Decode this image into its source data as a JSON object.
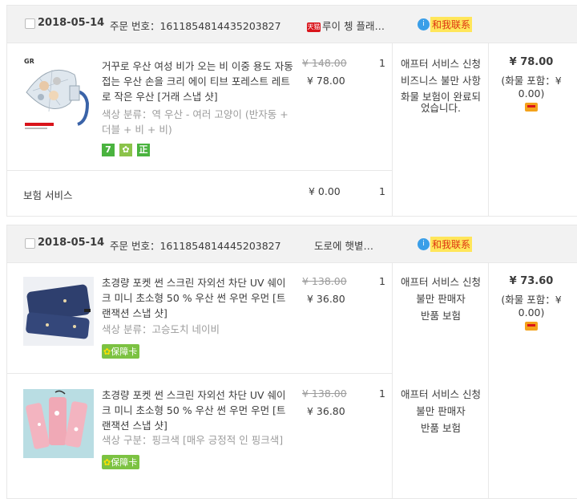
{
  "orders": [
    {
      "date": "2018-05-14",
      "order_no_label": "주문 번호：",
      "order_no": "1611854814435203827",
      "shop": {
        "tmall_label": "天猫",
        "name": "루이 쳉 플래…"
      },
      "contact": {
        "bubble": "i",
        "label": "和我联系"
      },
      "items": [
        {
          "title": "거꾸로 우산 여성 비가 오는 비 이중 용도 자동 접는 우산 손을 크리 에이 티브 포레스트 레트로 작은 우산 [거래 스냅 샷]",
          "sku": "색상 분류：역 우산 - 여러 고양이 (반자동 + 더블 + 비 + 비)",
          "badges": [
            "7",
            "✿",
            "正"
          ],
          "orig_price": "¥ 148.00",
          "price": "¥ 78.00",
          "qty": "1",
          "service": [
            "애프터 서비스 신청",
            "비즈니스 불만 사항",
            "화물 보험이 완료되었습니다."
          ]
        }
      ],
      "insurance": {
        "label": "보험 서비스",
        "price": "¥ 0.00",
        "qty": "1"
      },
      "total": "¥ 78.00",
      "shipping": "(화물 포함：¥ 0.00)"
    },
    {
      "date": "2018-05-14",
      "order_no_label": "주문 번호：",
      "order_no": "1611854814445203827",
      "shop": {
        "name": "도로에 햇볕…"
      },
      "contact": {
        "bubble": "i",
        "label": "和我联系"
      },
      "items": [
        {
          "title": "초경량 포켓 썬 스크린 자외선 차단 UV 쉐이크 미니 초소형 50 % 우산 썬 우먼 우먼 [트랜잭션 스냅 샷]",
          "sku": "색상 분류：고승도치 네이비",
          "guarantee": "保障卡",
          "orig_price": "¥ 138.00",
          "price": "¥ 36.80",
          "qty": "1",
          "service": [
            "애프터 서비스 신청",
            "불만 판매자",
            "반품 보험"
          ]
        },
        {
          "title": "초경량 포켓 썬 스크린 자외선 차단 UV 쉐이크 미니 초소형 50 % 우산 썬 우먼 우먼 [트랜잭션 스냅 샷]",
          "sku": "색상 구분：핑크색 [매우 긍정적 인 핑크색]",
          "guarantee": "保障卡",
          "orig_price": "¥ 138.00",
          "price": "¥ 36.80",
          "qty": "1",
          "service": [
            "애프터 서비스 신청",
            "불만 판매자",
            "반품 보험"
          ]
        }
      ],
      "total": "¥ 73.60",
      "shipping": "(화물 포함：¥ 0.00)"
    }
  ]
}
